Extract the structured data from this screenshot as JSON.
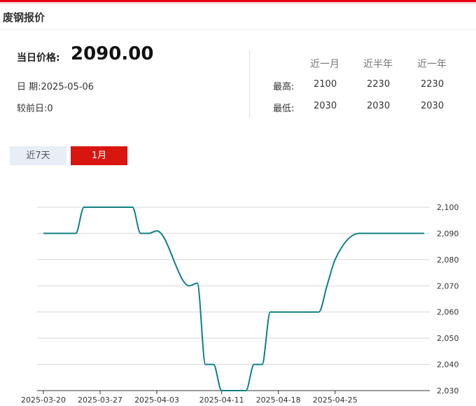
{
  "header": {
    "title": "废钢报价"
  },
  "price": {
    "label": "当日价格:",
    "value": "2090.00",
    "date_label": "日 期:",
    "date": "2025-05-06",
    "change_label": "较前日:",
    "change": "0"
  },
  "stats": {
    "columns": [
      "近一月",
      "近半年",
      "近一年"
    ],
    "rows": [
      {
        "label": "最高:",
        "values": [
          "2100",
          "2230",
          "2230"
        ]
      },
      {
        "label": "最低:",
        "values": [
          "2030",
          "2030",
          "2030"
        ]
      }
    ]
  },
  "tabs": [
    {
      "label": "近7天",
      "active": false
    },
    {
      "label": "1月",
      "active": true
    }
  ],
  "colors": {
    "accent": "#d9150f",
    "line": "#0e8080",
    "tab_inactive": "#e8eef6"
  },
  "chart_data": {
    "type": "line",
    "x_tick_labels": [
      "2025-03-20",
      "2025-03-27",
      "2025-04-03",
      "2025-04-11",
      "2025-04-18",
      "2025-04-25"
    ],
    "y_tick_labels": [
      "2,030",
      "2,040",
      "2,050",
      "2,060",
      "2,070",
      "2,080",
      "2,090",
      "2,100"
    ],
    "ylim": [
      2030,
      2100
    ],
    "grid": true,
    "y_axis_side": "right",
    "series": [
      {
        "x": [
          "2025-03-20",
          "2025-03-21",
          "2025-03-24",
          "2025-03-25",
          "2025-03-26",
          "2025-03-27",
          "2025-03-28",
          "2025-03-31",
          "2025-04-01",
          "2025-04-02",
          "2025-04-03",
          "2025-04-07",
          "2025-04-08",
          "2025-04-09",
          "2025-04-10",
          "2025-04-11",
          "2025-04-14",
          "2025-04-15",
          "2025-04-16",
          "2025-04-17",
          "2025-04-18",
          "2025-04-21",
          "2025-04-22",
          "2025-04-23",
          "2025-04-24",
          "2025-04-25",
          "2025-04-28",
          "2025-04-29",
          "2025-04-30",
          "2025-05-06"
        ],
        "values": [
          2090,
          2090,
          2090,
          2100,
          2100,
          2100,
          2100,
          2100,
          2090,
          2090,
          2091,
          2070,
          2071,
          2040,
          2040,
          2030,
          2030,
          2040,
          2040,
          2060,
          2060,
          2060,
          2060,
          2060,
          2070,
          2080,
          2090,
          2090,
          2090,
          2090
        ]
      }
    ]
  }
}
